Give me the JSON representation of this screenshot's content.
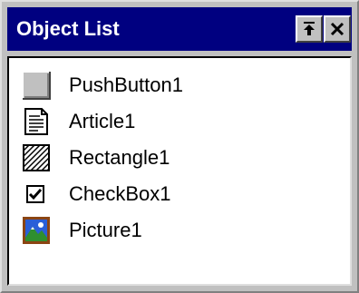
{
  "window": {
    "title": "Object List"
  },
  "titlebar_buttons": {
    "pin": "pin-icon",
    "close": "close-icon"
  },
  "objects": [
    {
      "label": "PushButton1",
      "icon": "pushbutton-icon"
    },
    {
      "label": "Article1",
      "icon": "article-icon"
    },
    {
      "label": "Rectangle1",
      "icon": "rectangle-icon"
    },
    {
      "label": "CheckBox1",
      "icon": "checkbox-icon"
    },
    {
      "label": "Picture1",
      "icon": "picture-icon"
    }
  ],
  "colors": {
    "titlebar": "#000080",
    "face": "#c0c0c0",
    "list_bg": "#ffffff"
  }
}
